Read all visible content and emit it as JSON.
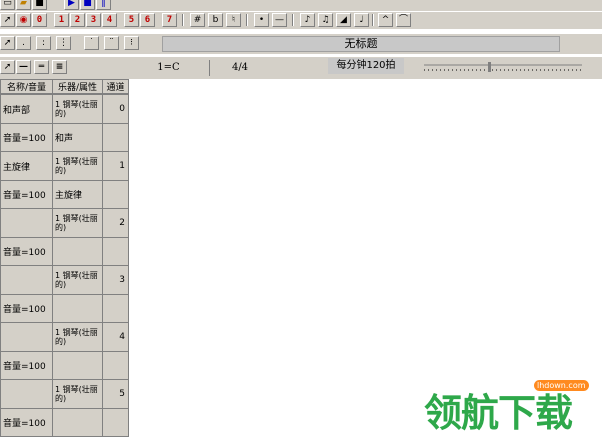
{
  "toolbar1": {
    "numbers": [
      "0",
      "1",
      "2",
      "3",
      "4",
      "5",
      "6",
      "7"
    ],
    "accidentals": [
      "#",
      "b",
      "♮"
    ],
    "dot_label": "•",
    "dash_label": "—"
  },
  "toolbar2": {
    "title": "无标题"
  },
  "toolbar3": {
    "key": "1=C",
    "time_sig": "4/4",
    "tempo": "每分钟120拍"
  },
  "grid": {
    "headers": [
      "名称/音量",
      "乐器/属性",
      "通道"
    ],
    "rows": [
      {
        "name": "和声部",
        "instrument": "钢琴(壮丽的)",
        "inst_prefix": "1",
        "channel": "0",
        "volume": "音量=100",
        "attr": "和声"
      },
      {
        "name": "主旋律",
        "instrument": "钢琴(壮丽的)",
        "inst_prefix": "1",
        "channel": "1",
        "volume": "音量=100",
        "attr": "主旋律"
      },
      {
        "name": "",
        "instrument": "钢琴(壮丽的)",
        "inst_prefix": "1",
        "channel": "2",
        "volume": "音量=100",
        "attr": ""
      },
      {
        "name": "",
        "instrument": "钢琴(壮丽的)",
        "inst_prefix": "1",
        "channel": "3",
        "volume": "音量=100",
        "attr": ""
      },
      {
        "name": "",
        "instrument": "钢琴(壮丽的)",
        "inst_prefix": "1",
        "channel": "4",
        "volume": "音量=100",
        "attr": ""
      },
      {
        "name": "",
        "instrument": "钢琴(壮丽的)",
        "inst_prefix": "1",
        "channel": "5",
        "volume": "音量=100",
        "attr": ""
      }
    ]
  },
  "watermark": {
    "text": "领航下载",
    "badge": "lhdown.com"
  },
  "colors": {
    "toolbar_bg": "#d4d0c8",
    "note_red": "#c00000",
    "watermark_green": "#2ea84a"
  }
}
